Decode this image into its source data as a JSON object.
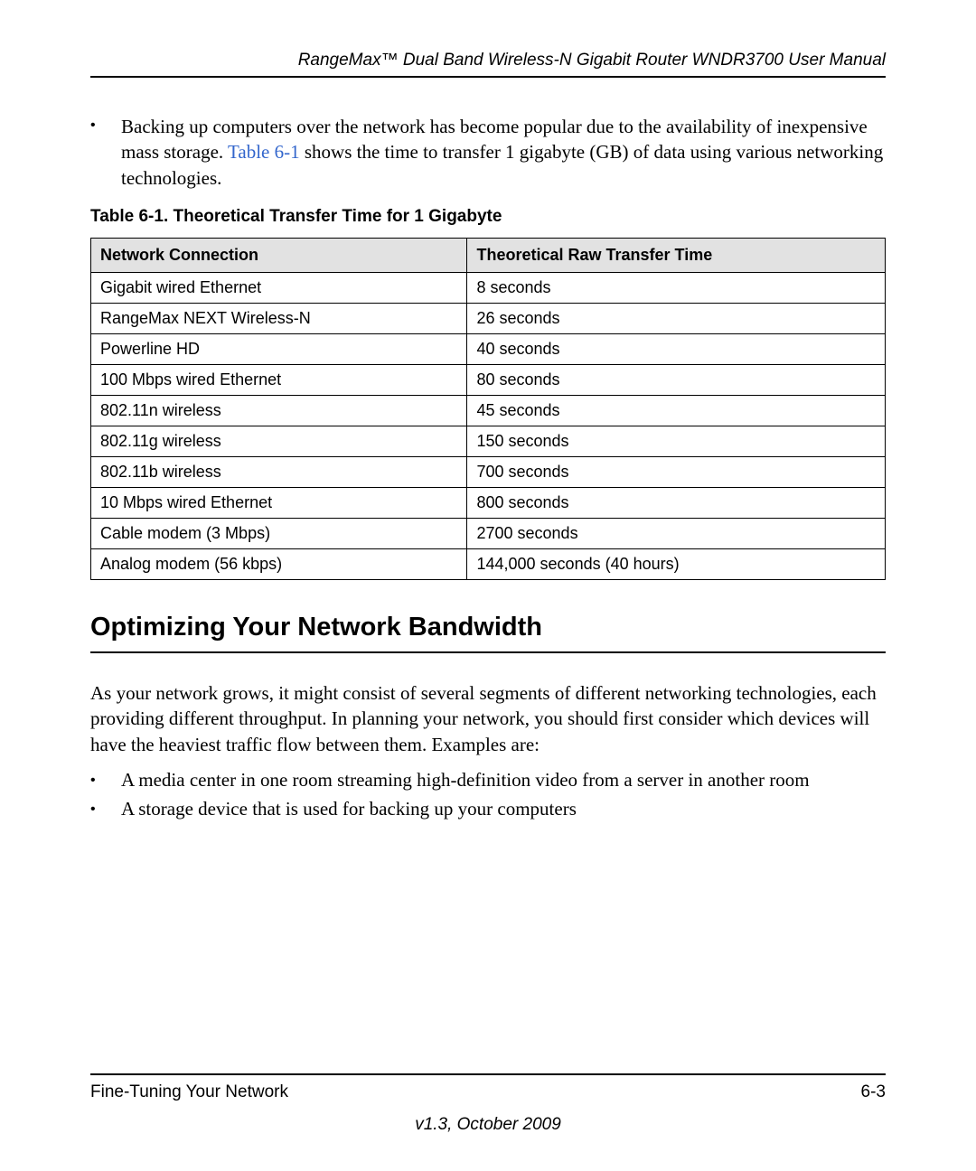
{
  "header": {
    "title": "RangeMax™ Dual Band Wireless-N Gigabit Router WNDR3700 User Manual"
  },
  "intro_bullet": {
    "pre": "Backing up computers over the network has become popular due to the availability of inexpensive mass storage. ",
    "link": "Table 6-1",
    "post": " shows the time to transfer 1 gigabyte (GB) of data using various networking technologies."
  },
  "table": {
    "caption": "Table 6-1.  Theoretical Transfer Time for 1 Gigabyte",
    "headers": [
      "Network Connection",
      "Theoretical Raw Transfer Time"
    ],
    "rows": [
      [
        "Gigabit wired Ethernet",
        "8 seconds"
      ],
      [
        "RangeMax NEXT Wireless-N",
        "26 seconds"
      ],
      [
        "Powerline HD",
        "40 seconds"
      ],
      [
        "100 Mbps wired Ethernet",
        "80 seconds"
      ],
      [
        "802.11n wireless",
        "45 seconds"
      ],
      [
        "802.11g wireless",
        "150 seconds"
      ],
      [
        "802.11b wireless",
        "700 seconds"
      ],
      [
        "10 Mbps wired Ethernet",
        "800 seconds"
      ],
      [
        "Cable modem (3 Mbps)",
        "2700 seconds"
      ],
      [
        "Analog modem (56 kbps)",
        "144,000 seconds (40 hours)"
      ]
    ]
  },
  "section": {
    "heading": "Optimizing Your Network Bandwidth",
    "para": "As your network grows, it might consist of several segments of different networking technologies, each providing different throughput. In planning your network, you should first consider which devices will have the heaviest traffic flow between them. Examples are:",
    "bullets": [
      "A media center in one room streaming high-definition video from a server in another room",
      "A storage device that is used for backing up your computers"
    ]
  },
  "footer": {
    "left": "Fine-Tuning Your Network",
    "right": "6-3",
    "version": "v1.3, October 2009"
  },
  "chart_data": {
    "type": "table",
    "title": "Theoretical Transfer Time for 1 Gigabyte",
    "columns": [
      "Network Connection",
      "Theoretical Raw Transfer Time"
    ],
    "rows": [
      {
        "connection": "Gigabit wired Ethernet",
        "time": "8 seconds"
      },
      {
        "connection": "RangeMax NEXT Wireless-N",
        "time": "26 seconds"
      },
      {
        "connection": "Powerline HD",
        "time": "40 seconds"
      },
      {
        "connection": "100 Mbps wired Ethernet",
        "time": "80 seconds"
      },
      {
        "connection": "802.11n wireless",
        "time": "45 seconds"
      },
      {
        "connection": "802.11g wireless",
        "time": "150 seconds"
      },
      {
        "connection": "802.11b wireless",
        "time": "700 seconds"
      },
      {
        "connection": "10 Mbps wired Ethernet",
        "time": "800 seconds"
      },
      {
        "connection": "Cable modem (3 Mbps)",
        "time": "2700 seconds"
      },
      {
        "connection": "Analog modem (56 kbps)",
        "time": "144,000 seconds (40 hours)"
      }
    ]
  }
}
